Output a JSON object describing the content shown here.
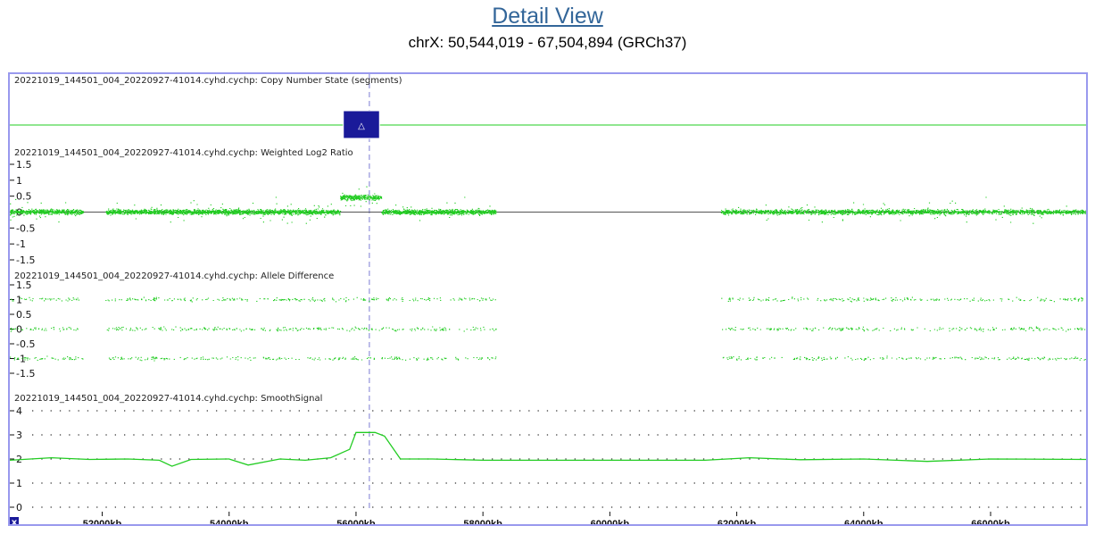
{
  "header": {
    "title": "Detail View",
    "subtitle": "chrX: 50,544,019 - 67,504,894 (GRCh37)"
  },
  "colors": {
    "data": "#22cc22",
    "frame": "#9999ee",
    "cursor": "#9999dd",
    "marker": "#1a1a99",
    "title_link": "#336699"
  },
  "x_axis": {
    "range_kb": [
      50544,
      67505
    ],
    "ticks": [
      "52000kb",
      "54000kb",
      "56000kb",
      "58000kb",
      "60000kb",
      "62000kb",
      "64000kb",
      "66000kb"
    ],
    "tick_values_kb": [
      52000,
      54000,
      56000,
      58000,
      60000,
      62000,
      64000,
      66000
    ],
    "corner_button": "x",
    "cursor_kb": 56210
  },
  "chart_data": [
    {
      "type": "scatter",
      "panel_title": "20221019_144501_004_20220927-41014.cyhd.cychp: Copy Number State (segments)",
      "baseline": 2,
      "segments": [
        {
          "start_kb": 55800,
          "end_kb": 56370,
          "label": "△",
          "state": "gain"
        }
      ]
    },
    {
      "type": "scatter",
      "panel_title": "20221019_144501_004_20220927-41014.cyhd.cychp: Weighted Log2 Ratio",
      "y_ticks": [
        "1.5",
        "1",
        "0.5",
        "0",
        "-0.5",
        "-1",
        "-1.5"
      ],
      "y_tick_values": [
        1.5,
        1,
        0.5,
        0,
        -0.5,
        -1,
        -1.5
      ],
      "ylim": [
        -1.5,
        1.5
      ],
      "data_regions": [
        {
          "start_kb": 50544,
          "end_kb": 51700,
          "center": 0.0
        },
        {
          "start_kb": 52050,
          "end_kb": 55750,
          "center": 0.0
        },
        {
          "start_kb": 55750,
          "end_kb": 56400,
          "center": 0.45
        },
        {
          "start_kb": 56400,
          "end_kb": 58200,
          "center": 0.0
        },
        {
          "start_kb": 61750,
          "end_kb": 67505,
          "center": 0.0
        }
      ]
    },
    {
      "type": "scatter",
      "panel_title": "20221019_144501_004_20220927-41014.cyhd.cychp: Allele Difference",
      "y_ticks": [
        "1.5",
        "1",
        "0.5",
        "0",
        "-0.5",
        "-1",
        "-1.5"
      ],
      "y_tick_values": [
        1.5,
        1,
        0.5,
        0,
        -0.5,
        -1,
        -1.5
      ],
      "ylim": [
        -1.5,
        1.5
      ],
      "bands": [
        1,
        0,
        -1
      ],
      "data_regions": [
        {
          "start_kb": 50544,
          "end_kb": 51700
        },
        {
          "start_kb": 52050,
          "end_kb": 58200
        },
        {
          "start_kb": 61750,
          "end_kb": 67505
        }
      ]
    },
    {
      "type": "line",
      "panel_title": "20221019_144501_004_20220927-41014.cyhd.cychp: SmoothSignal",
      "y_ticks": [
        "4",
        "3",
        "2",
        "1",
        "0"
      ],
      "y_tick_values": [
        4,
        3,
        2,
        1,
        0
      ],
      "ylim": [
        0,
        4
      ],
      "grid": true,
      "x": [
        50544,
        51200,
        51800,
        52400,
        52900,
        53100,
        53400,
        54000,
        54300,
        54800,
        55200,
        55600,
        55900,
        56000,
        56300,
        56450,
        56700,
        57200,
        58000,
        60000,
        61500,
        62200,
        63000,
        64000,
        65000,
        66000,
        67505
      ],
      "y": [
        1.95,
        2.05,
        1.98,
        2.0,
        1.95,
        1.7,
        1.98,
        2.0,
        1.75,
        2.0,
        1.95,
        2.05,
        2.4,
        3.1,
        3.1,
        2.95,
        2.0,
        2.0,
        1.95,
        1.95,
        1.95,
        2.05,
        1.97,
        2.0,
        1.9,
        2.0,
        1.98
      ]
    }
  ]
}
